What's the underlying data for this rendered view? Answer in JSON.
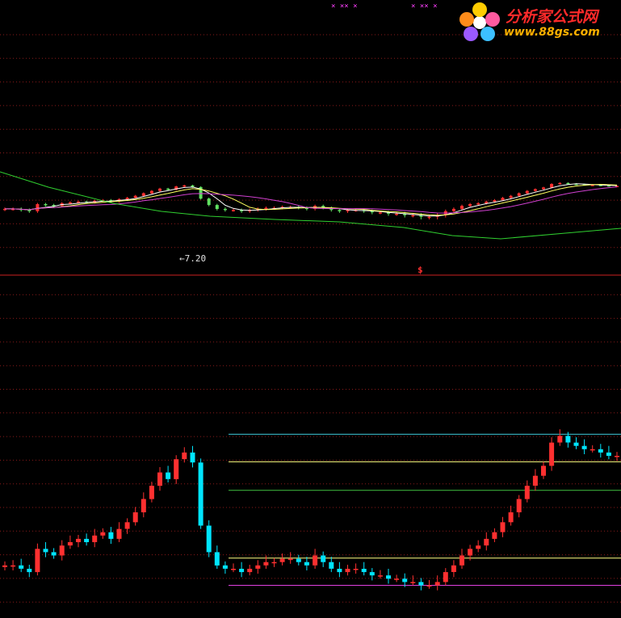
{
  "watermark": {
    "brand": "分析家公式网",
    "url": "www.88gs.com"
  },
  "markers": {
    "left": "× ××  ×",
    "right": "×  ×× ×"
  },
  "upper_panel": {
    "low_annotation": "7.20",
    "signal_symbol": "$"
  },
  "colors": {
    "background": "#000000",
    "grid": "#8a1a1a",
    "up_candle": "#ff3030",
    "down_candle": "#00e5ff",
    "upper_down": "#60e060",
    "ma_white": "#ffffff",
    "ma_yellow": "#ffff60",
    "ma_magenta": "#d040d0",
    "ma_green": "#30d030",
    "level_cyan": "#40d0e0",
    "level_yellow": "#ffff80",
    "level_green": "#40c040",
    "level_magenta": "#e040e0"
  },
  "chart_data": {
    "type": "candlestick",
    "note_levels": [
      "cyan",
      "yellow",
      "green",
      "yellow",
      "magenta"
    ],
    "lower_closes": [
      100,
      100,
      99,
      98,
      105,
      104,
      103,
      106,
      107,
      108,
      107,
      109,
      110,
      108,
      111,
      113,
      116,
      120,
      124,
      128,
      126,
      132,
      134,
      131,
      112,
      104,
      100,
      99,
      99,
      98,
      99,
      100,
      101,
      101,
      102,
      102,
      101,
      100,
      103,
      101,
      99,
      98,
      99,
      99,
      98,
      97,
      97,
      96,
      96,
      95,
      95,
      94,
      94,
      95,
      98,
      100,
      103,
      105,
      106,
      108,
      110,
      113,
      116,
      120,
      124,
      127,
      130,
      137,
      139,
      137,
      136,
      135,
      135,
      134,
      133,
      133
    ]
  }
}
